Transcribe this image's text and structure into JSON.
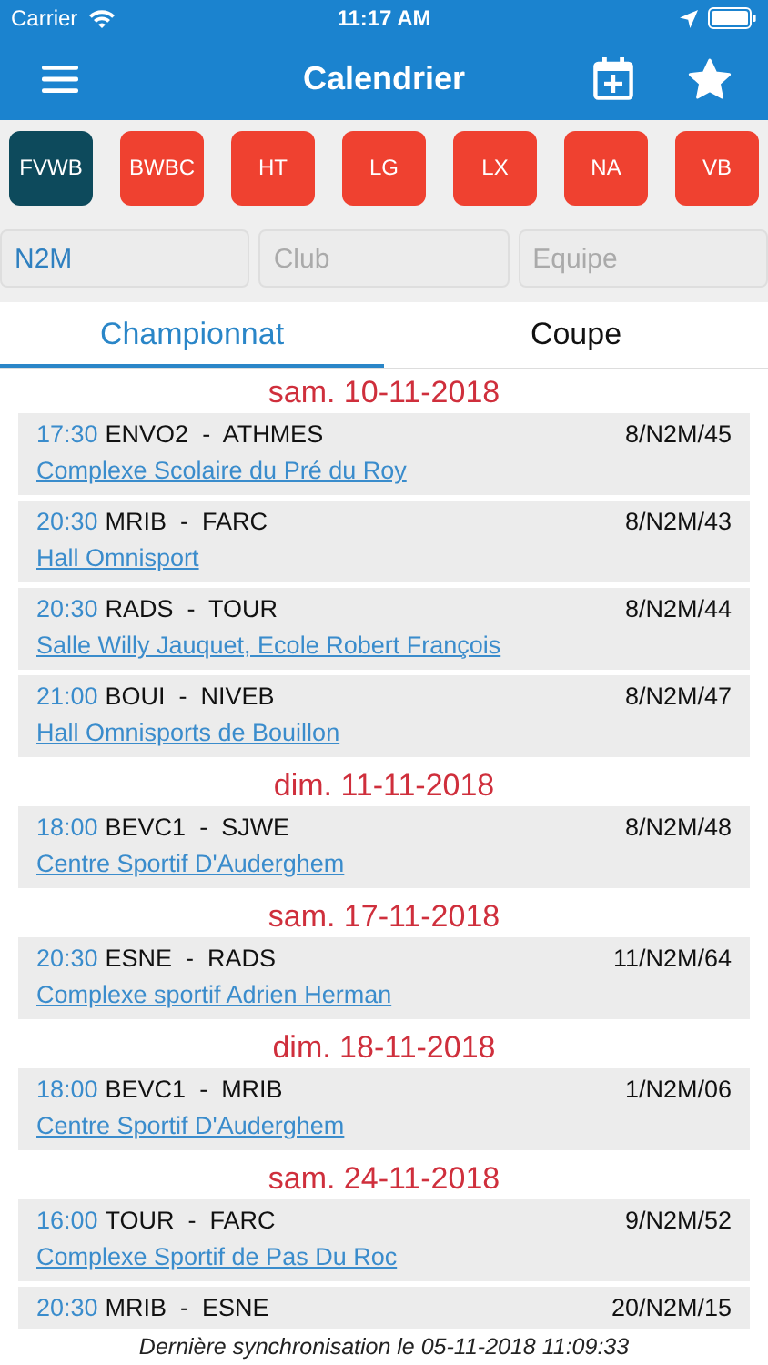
{
  "status_bar": {
    "carrier": "Carrier",
    "time": "11:17 AM"
  },
  "nav": {
    "title": "Calendrier"
  },
  "chips": [
    {
      "label": "FVWB",
      "selected": true
    },
    {
      "label": "BWBC",
      "selected": false
    },
    {
      "label": "HT",
      "selected": false
    },
    {
      "label": "LG",
      "selected": false
    },
    {
      "label": "LX",
      "selected": false
    },
    {
      "label": "NA",
      "selected": false
    },
    {
      "label": "VB",
      "selected": false
    }
  ],
  "filters": [
    {
      "value": "N2M"
    },
    {
      "placeholder": "Club"
    },
    {
      "placeholder": "Equipe"
    }
  ],
  "tabs": [
    {
      "label": "Championnat",
      "selected": true
    },
    {
      "label": "Coupe",
      "selected": false
    }
  ],
  "days": [
    {
      "date": "sam. 10-11-2018",
      "matches": [
        {
          "time": "17:30",
          "teams": "ENVO2  -  ATHMES",
          "code": "8/N2M/45",
          "venue": "Complexe Scolaire du Pré du Roy"
        },
        {
          "time": "20:30",
          "teams": "MRIB  -  FARC",
          "code": "8/N2M/43",
          "venue": "Hall Omnisport"
        },
        {
          "time": "20:30",
          "teams": "RADS  -  TOUR",
          "code": "8/N2M/44",
          "venue": "Salle Willy Jauquet, Ecole Robert François"
        },
        {
          "time": "21:00",
          "teams": "BOUI  -  NIVEB",
          "code": "8/N2M/47",
          "venue": "Hall Omnisports de Bouillon"
        }
      ]
    },
    {
      "date": "dim. 11-11-2018",
      "matches": [
        {
          "time": "18:00",
          "teams": "BEVC1  -  SJWE",
          "code": "8/N2M/48",
          "venue": "Centre Sportif D'Auderghem"
        }
      ]
    },
    {
      "date": "sam. 17-11-2018",
      "matches": [
        {
          "time": "20:30",
          "teams": "ESNE  -  RADS",
          "code": "11/N2M/64",
          "venue": "Complexe sportif Adrien Herman"
        }
      ]
    },
    {
      "date": "dim. 18-11-2018",
      "matches": [
        {
          "time": "18:00",
          "teams": "BEVC1  -  MRIB",
          "code": "1/N2M/06",
          "venue": "Centre Sportif D'Auderghem"
        }
      ]
    },
    {
      "date": "sam. 24-11-2018",
      "matches": [
        {
          "time": "16:00",
          "teams": "TOUR  -  FARC",
          "code": "9/N2M/52",
          "venue": "Complexe Sportif de Pas Du Roc"
        },
        {
          "time": "20:30",
          "teams": "MRIB  -  ESNE",
          "code": "20/N2M/15"
        }
      ]
    }
  ],
  "footer": "Dernière synchronisation le 05-11-2018 11:09:33"
}
